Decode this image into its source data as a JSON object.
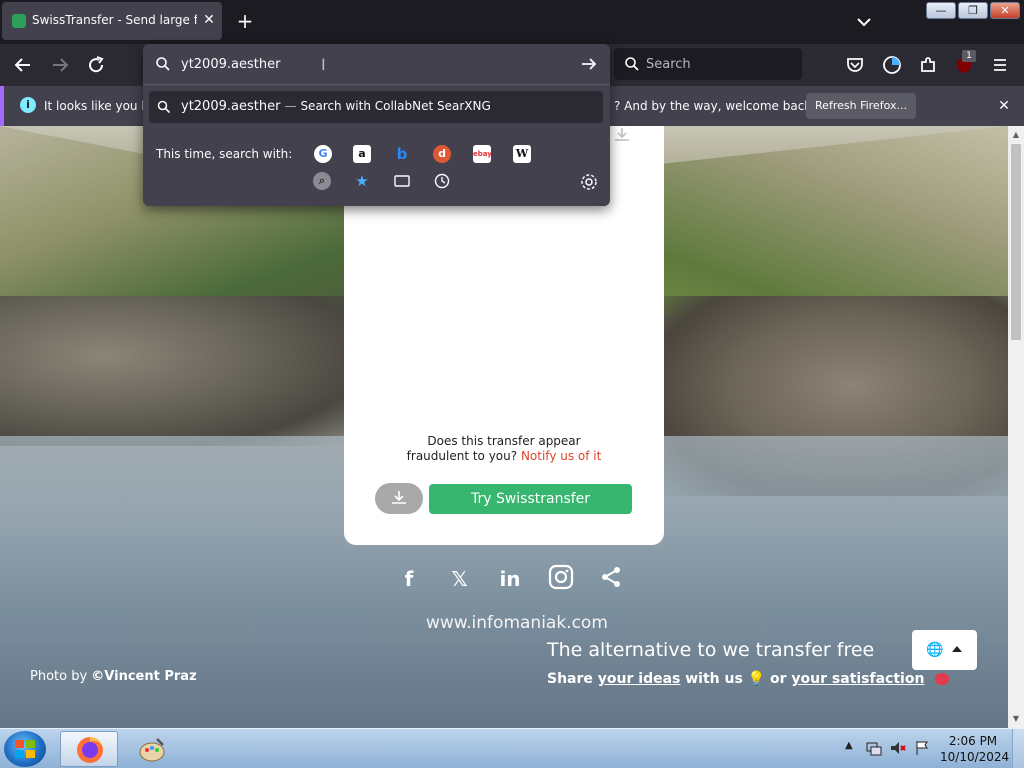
{
  "browser": {
    "tab": {
      "title": "SwissTransfer - Send large files"
    },
    "searchbar": {
      "placeholder": "Search"
    },
    "extension_badge": "1"
  },
  "notification": {
    "text_left": "It looks like you ha",
    "text_right": "? And by the way, welcome back!",
    "refresh_label": "Refresh Firefox..."
  },
  "urlbar": {
    "value": "yt2009.aesther",
    "suggestion": {
      "query": "yt2009.aesther",
      "separator": "—",
      "engine_text": "Search with CollabNet SearXNG"
    },
    "this_time_label": "This time, search with:",
    "engines": [
      "google-icon",
      "amazon-icon",
      "bing-icon",
      "duckduckgo-icon",
      "ebay-icon",
      "wikipedia-icon",
      "searxng-icon",
      "bookmarks-icon",
      "tabs-icon",
      "history-icon"
    ]
  },
  "page": {
    "fraud_question": "Does this transfer appear",
    "fraud_question2": "fraudulent to you?",
    "notify_link": "Notify us of it",
    "try_button": "Try Swisstransfer",
    "site_url": "www.infomaniak.com",
    "tagline": "The alternative to we transfer free",
    "share_prefix": "Share",
    "share_ideas": "your ideas",
    "share_mid": "with us",
    "share_or": "or",
    "share_satisfaction": "your satisfaction",
    "photo_credit_prefix": "Photo by ",
    "photo_credit_author": "©Vincent Praz"
  },
  "taskbar": {
    "time": "2:06 PM",
    "date": "10/10/2024"
  },
  "colors": {
    "accent_green": "#37b66f",
    "notify_red": "#d9452b",
    "firefox_dark": "#2b2a33"
  }
}
